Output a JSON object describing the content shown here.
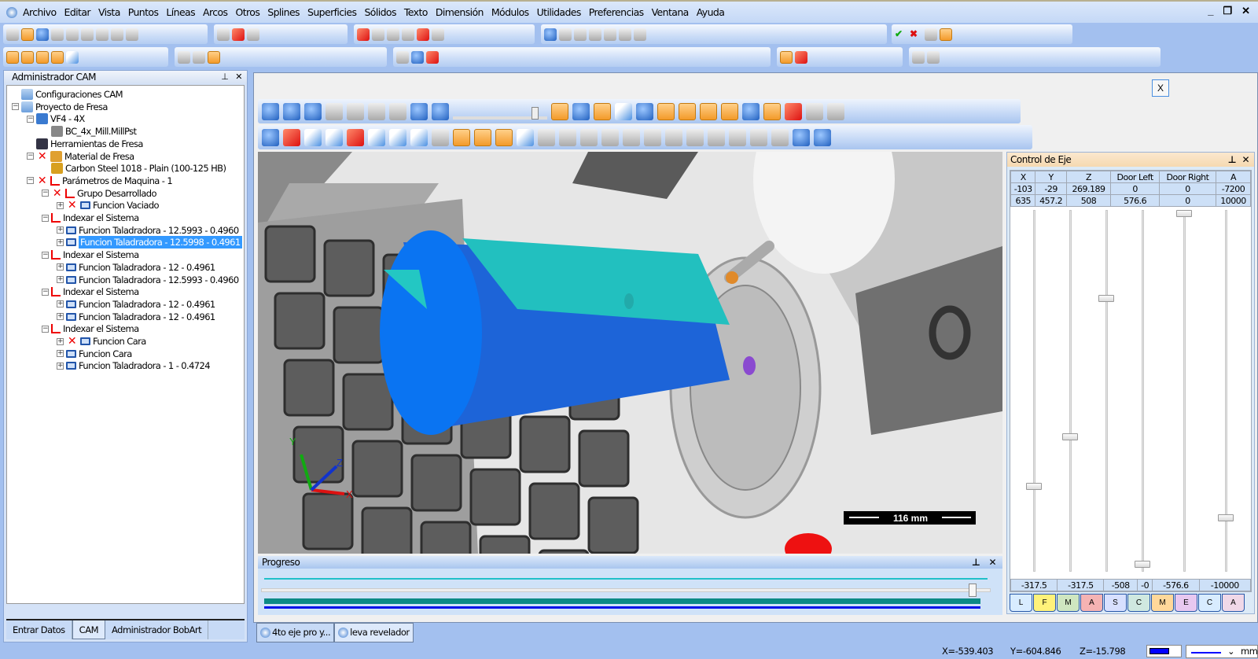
{
  "menu": [
    "Archivo",
    "Editar",
    "Vista",
    "Puntos",
    "Líneas",
    "Arcos",
    "Otros",
    "Splines",
    "Superficies",
    "Sólidos",
    "Texto",
    "Dimensión",
    "Módulos",
    "Utilidades",
    "Preferencias",
    "Ventana",
    "Ayuda"
  ],
  "window_buttons": {
    "minimize": "_",
    "restore": "❐",
    "close": "✕"
  },
  "left_panel": {
    "title": "Administrador CAM",
    "pin": "⊥",
    "close": "✕",
    "tree": [
      {
        "label": "Configuraciones CAM",
        "icon": "folder-icon"
      },
      {
        "label": "Proyecto de Fresa",
        "icon": "folder-icon"
      },
      {
        "label": "VF4 - 4X",
        "icon": "machine-icon"
      },
      {
        "label": "BC_4x_Mill.MillPst",
        "icon": "post-file-icon"
      },
      {
        "label": "Herramientas de Fresa",
        "icon": "tool-icon"
      },
      {
        "label": "Material de Fresa",
        "icon": "material-icon"
      },
      {
        "label": "Carbon Steel 1018 - Plain (100-125 HB)",
        "icon": "steel-icon"
      },
      {
        "label": "Parámetros de Maquina - 1",
        "icon": "axes-icon"
      },
      {
        "label": "Grupo Desarrollado",
        "icon": "axes-icon"
      },
      {
        "label": "Funcion Vaciado",
        "icon": "operation-icon"
      },
      {
        "label": "Indexar el Sistema",
        "icon": "axes-icon"
      },
      {
        "label": "Funcion Taladradora - 12.5993 - 0.4960",
        "icon": "operation-icon"
      },
      {
        "label": "Funcion Taladradora - 12.5998 - 0.4961",
        "icon": "operation-icon"
      },
      {
        "label": "Indexar el Sistema",
        "icon": "axes-icon"
      },
      {
        "label": "Funcion Taladradora - 12 - 0.4961",
        "icon": "operation-icon"
      },
      {
        "label": "Funcion Taladradora - 12.5993 - 0.4960",
        "icon": "operation-icon"
      },
      {
        "label": "Indexar el Sistema",
        "icon": "axes-icon"
      },
      {
        "label": "Funcion Taladradora - 12 - 0.4961",
        "icon": "operation-icon"
      },
      {
        "label": "Funcion Taladradora - 12 - 0.4961",
        "icon": "operation-icon"
      },
      {
        "label": "Indexar el Sistema",
        "icon": "axes-icon"
      },
      {
        "label": "Funcion Cara",
        "icon": "operation-icon"
      },
      {
        "label": "Funcion Cara",
        "icon": "operation-icon"
      },
      {
        "label": "Funcion Taladradora - 1 - 0.4724",
        "icon": "operation-icon"
      }
    ],
    "tabs": [
      "Entrar Datos",
      "CAM",
      "Administrador BobArt"
    ]
  },
  "doc_close": "X",
  "viewport": {
    "scale_label": "116  mm",
    "axis_x": "X",
    "axis_y": "Y",
    "axis_z": "Z"
  },
  "axis_control": {
    "title": "Control de Eje",
    "pin": "⊥",
    "close": "✕",
    "headers": [
      "X",
      "Y",
      "Z",
      "Door Left",
      "Door Right",
      "A"
    ],
    "min_row": [
      "-103",
      "-29",
      "269.189",
      "0",
      "0",
      "-7200"
    ],
    "max_row": [
      "635",
      "457.2",
      "508",
      "576.6",
      "0",
      "10000"
    ],
    "current_row": [
      "-317.5",
      "-317.5",
      "-508",
      "-0",
      "-576.6",
      "-10000"
    ],
    "slider_levels": [
      0.23,
      0.37,
      0.76,
      0.01,
      1.0,
      0.14
    ],
    "tabs": [
      "L",
      "F",
      "M",
      "A",
      "S",
      "C",
      "M",
      "E",
      "C",
      "A"
    ]
  },
  "progress": {
    "title": "Progreso",
    "pin": "⊥",
    "close": "✕",
    "value": 0.98
  },
  "doc_tabs": [
    "4to eje pro y...",
    "leva revelador"
  ],
  "status": {
    "x": "X=-539.403",
    "y": "Y=-604.846",
    "z": "Z=-15.798",
    "units": "mm",
    "color": "#0000ff"
  }
}
